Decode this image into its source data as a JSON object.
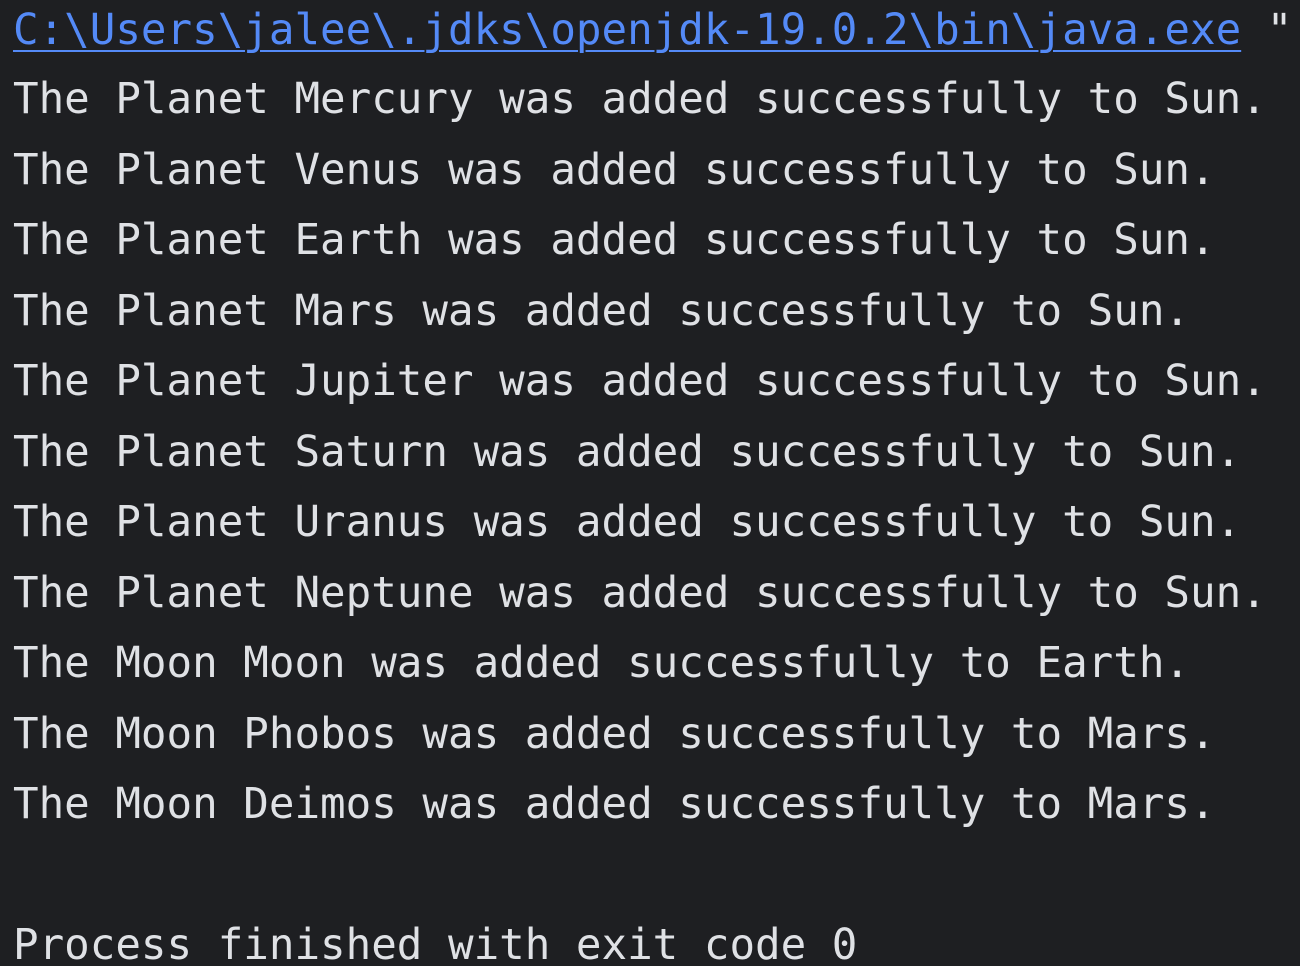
{
  "console": {
    "command_path": "C:\\Users\\jalee\\.jdks\\openjdk-19.0.2\\bin\\java.exe",
    "command_rest": " \"",
    "output_lines": [
      "The Planet Mercury was added successfully to Sun.",
      "The Planet Venus was added successfully to Sun.",
      "The Planet Earth was added successfully to Sun.",
      "The Planet Mars was added successfully to Sun.",
      "The Planet Jupiter was added successfully to Sun.",
      "The Planet Saturn was added successfully to Sun.",
      "The Planet Uranus was added successfully to Sun.",
      "The Planet Neptune was added successfully to Sun.",
      "The Moon Moon was added successfully to Earth.",
      "The Moon Phobos was added successfully to Mars.",
      "The Moon Deimos was added successfully to Mars."
    ],
    "exit_message": "Process finished with exit code 0"
  },
  "colors": {
    "background": "#1e1f22",
    "text": "#dfe1e5",
    "link": "#548af7"
  }
}
